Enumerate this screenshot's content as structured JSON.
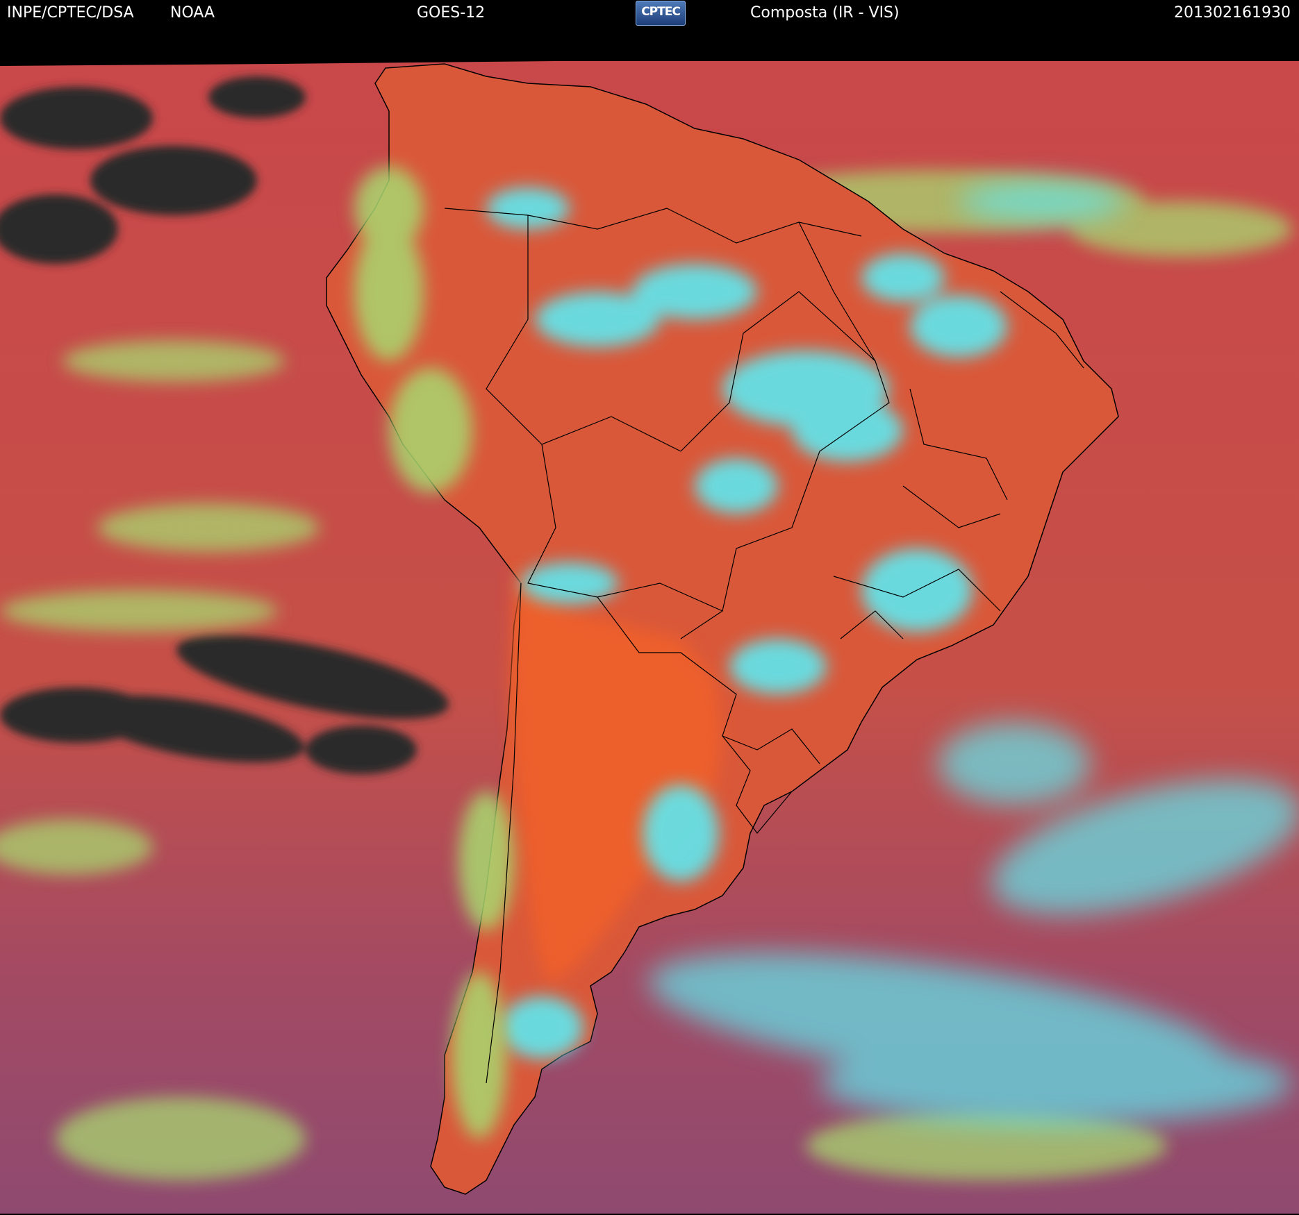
{
  "header": {
    "org": "INPE/CPTEC/DSA",
    "agency": "NOAA",
    "satellite": "GOES-12",
    "logo_text": "CPTEC",
    "product": "Composta (IR - VIS)",
    "timestamp": "201302161930"
  },
  "colors": {
    "ocean": "#c9474a",
    "land_dry": "#f0612a",
    "cloud_high": "#5fe8f0",
    "cloud_low": "#a8d870",
    "clear_ocean_dark": "#2a2a2a",
    "coastline": "#000000",
    "header_bg": "#000000",
    "header_text": "#ffffff"
  }
}
